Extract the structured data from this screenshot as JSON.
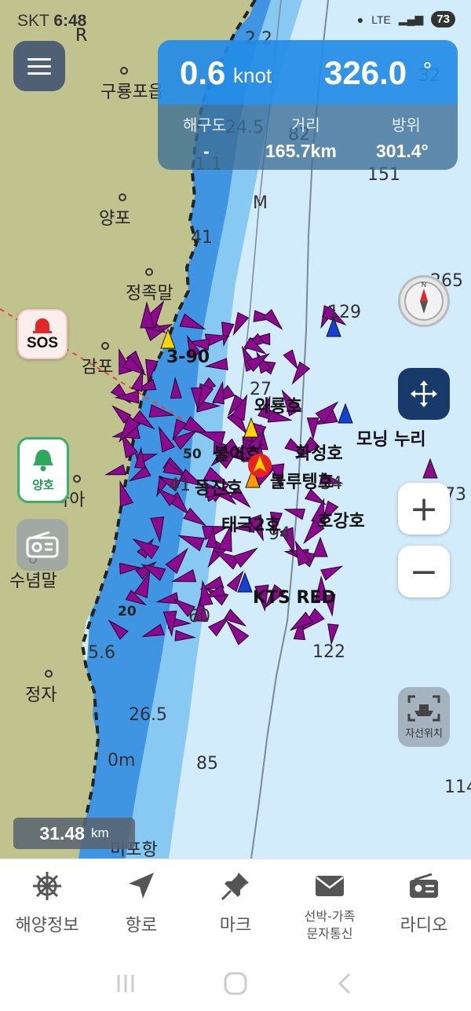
{
  "status_bar": {
    "carrier": "SKT",
    "time": "6:48",
    "network": "LTE",
    "battery": "73"
  },
  "nav_panel": {
    "speed": "0.6",
    "speed_unit": "knot",
    "heading": "326.0",
    "heading_unit": "°",
    "chart_label": "해구도",
    "chart_value": "-",
    "distance_label": "거리",
    "distance_value": "165.7km",
    "bearing_label": "방위",
    "bearing_value": "301.4°"
  },
  "map": {
    "place_labels": [
      "구룡포읍",
      "양포",
      "정족말",
      "감포",
      "라아",
      "수념말",
      "정자",
      "미포항",
      "R"
    ],
    "depth_labels": [
      "2.2",
      "32",
      "24.5",
      "82",
      "1.1",
      "151",
      "M",
      "41",
      "129",
      "265",
      "27",
      "50",
      "34",
      "41",
      "94",
      "20",
      "60",
      "122",
      "5.6",
      "26.5",
      "85",
      "114",
      "0m",
      "73"
    ],
    "vessel_labels": [
      "3-90",
      "와룡호",
      "모닝 누리",
      "동진호",
      "블루텡호",
      "화성호",
      "태극2호",
      "호강호",
      "KTS RED",
      "불어호"
    ],
    "colors": {
      "land": "#c0c28f",
      "shallow": "#3a8fe0",
      "mid": "#7ec3f2",
      "deep": "#cfe9f9",
      "vessel": "#8b0a8e",
      "own_ship": "#e8231f",
      "track": "#e04a3a"
    }
  },
  "buttons": {
    "sos": "SOS",
    "yangho": "양호",
    "myloc": "자선위치",
    "zoom_in": "+",
    "zoom_out": "−"
  },
  "scale": {
    "value": "31.48",
    "unit": "km"
  },
  "bottom_nav": [
    {
      "label": "해양정보",
      "icon": "ship-wheel-icon"
    },
    {
      "label": "항로",
      "icon": "navigation-arrow-icon"
    },
    {
      "label": "마크",
      "icon": "pushpin-icon"
    },
    {
      "label_line1": "선박-가족",
      "label_line2": "문자통신",
      "icon": "envelope-icon"
    },
    {
      "label": "라디오",
      "icon": "radio-icon"
    }
  ]
}
